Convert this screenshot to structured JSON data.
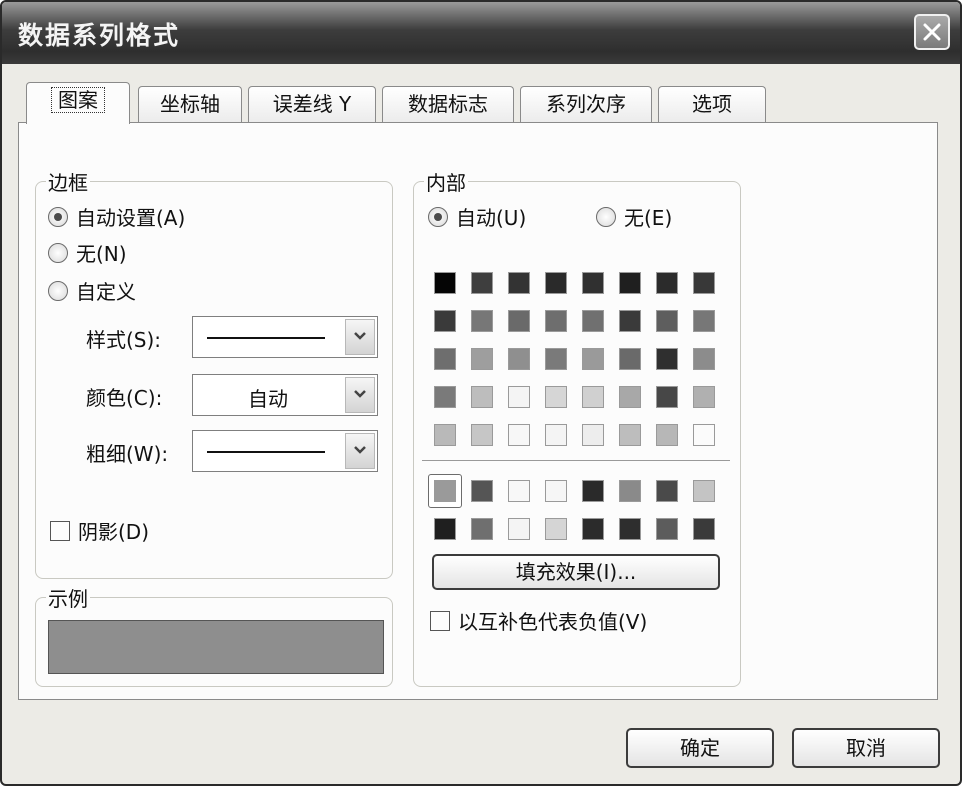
{
  "window": {
    "title": "数据系列格式"
  },
  "tabs": [
    {
      "label": "图案"
    },
    {
      "label": "坐标轴"
    },
    {
      "label": "误差线 Y"
    },
    {
      "label": "数据标志"
    },
    {
      "label": "系列次序"
    },
    {
      "label": "选项"
    }
  ],
  "border": {
    "legend": "边框",
    "auto_label": "自动设置(A)",
    "none_label": "无(N)",
    "custom_label": "自定义",
    "selected": "auto",
    "style_label": "样式(S):",
    "color_label": "颜色(C):",
    "color_value": "自动",
    "weight_label": "粗细(W):",
    "shadow_label": "阴影(D)",
    "shadow_checked": false
  },
  "sample": {
    "legend": "示例",
    "color": "#8e8e8e"
  },
  "interior": {
    "legend": "内部",
    "auto_label": "自动(U)",
    "none_label": "无(E)",
    "selected": "auto",
    "palette": [
      [
        "#050505",
        "#3e3e3e",
        "#333333",
        "#2a2a2a",
        "#303030",
        "#1f1f1f",
        "#2b2b2b",
        "#383838"
      ],
      [
        "#3a3a3a",
        "#777777",
        "#6a6a6a",
        "#6e6e6e",
        "#707070",
        "#3a3a3a",
        "#5e5e5e",
        "#777777"
      ],
      [
        "#6e6e6e",
        "#9e9e9e",
        "#8f8f8f",
        "#7a7a7a",
        "#9a9a9a",
        "#6a6a6a",
        "#2f2f2f",
        "#8c8c8c"
      ],
      [
        "#7a7a7a",
        "#bdbdbd",
        "#f4f4f4",
        "#d6d6d6",
        "#d0d0d0",
        "#a8a8a8",
        "#474747",
        "#b0b0b0"
      ],
      [
        "#b9b9b9",
        "#c6c6c6",
        "#f7f7f7",
        "#f4f4f4",
        "#ededed",
        "#bdbdbd",
        "#b7b7b7",
        "#fbfbfb"
      ]
    ],
    "extra_palette": [
      [
        "#9a9a9a",
        "#555555",
        "#f8f8f8",
        "#f6f6f6",
        "#2a2a2a",
        "#8a8a8a",
        "#4a4a4a",
        "#c4c4c4"
      ],
      [
        "#1f1f1f",
        "#6f6f6f",
        "#f4f4f4",
        "#d5d5d5",
        "#2b2b2b",
        "#2e2e2e",
        "#5c5c5c",
        "#3a3a3a"
      ]
    ],
    "fill_effects_label": "填充效果(I)...",
    "invert_label": "以互补色代表负值(V)",
    "invert_checked": false
  },
  "buttons": {
    "ok": "确定",
    "cancel": "取消"
  }
}
